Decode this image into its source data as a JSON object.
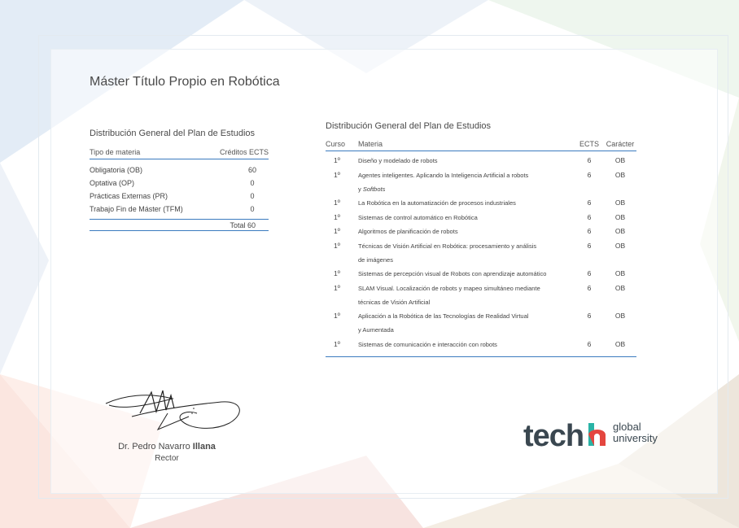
{
  "document": {
    "title": "Máster Título Propio en Robótica"
  },
  "summary_table": {
    "heading": "Distribución General del Plan de Estudios",
    "col_type": "Tipo de materia",
    "col_credits": "Créditos ECTS",
    "rows": [
      {
        "type": "Obligatoria (OB)",
        "credits": "60"
      },
      {
        "type": "Optativa (OP)",
        "credits": "0"
      },
      {
        "type": "Prácticas Externas (PR)",
        "credits": "0"
      },
      {
        "type": "Trabajo Fin de Máster (TFM)",
        "credits": "0"
      }
    ],
    "total": "Total 60"
  },
  "courses_table": {
    "heading": "Distribución General del Plan de Estudios",
    "col_course": "Curso",
    "col_subject": "Materia",
    "col_ects": "ECTS",
    "col_character": "Carácter",
    "rows": [
      {
        "course": "1º",
        "subject": "Diseño y modelado de robots",
        "subject2": "",
        "ects": "6",
        "character": "OB"
      },
      {
        "course": "1º",
        "subject": "Agentes inteligentes. Aplicando la Inteligencia Artificial a robots",
        "subject2": "y Softbots",
        "ects": "6",
        "character": "OB"
      },
      {
        "course": "1º",
        "subject": "La Robótica en la automatización de procesos industriales",
        "subject2": "",
        "ects": "6",
        "character": "OB"
      },
      {
        "course": "1º",
        "subject": "Sistemas de control automático en Robótica",
        "subject2": "",
        "ects": "6",
        "character": "OB"
      },
      {
        "course": "1º",
        "subject": "Algoritmos de planificación de robots",
        "subject2": "",
        "ects": "6",
        "character": "OB"
      },
      {
        "course": "1º",
        "subject": "Técnicas de Visión Artificial en Robótica: procesamiento y análisis",
        "subject2": "de imágenes",
        "ects": "6",
        "character": "OB"
      },
      {
        "course": "1º",
        "subject": "Sistemas de percepción visual de Robots con aprendizaje automático",
        "subject2": "",
        "ects": "6",
        "character": "OB"
      },
      {
        "course": "1º",
        "subject": "SLAM Visual. Localización de robots y mapeo simultáneo mediante",
        "subject2": "técnicas de Visión Artificial",
        "ects": "6",
        "character": "OB"
      },
      {
        "course": "1º",
        "subject": "Aplicación a la Robótica de las Tecnologías de Realidad Virtual",
        "subject2": "y Aumentada",
        "ects": "6",
        "character": "OB"
      },
      {
        "course": "1º",
        "subject": "Sistemas de comunicación e interacción con robots",
        "subject2": "",
        "ects": "6",
        "character": "OB"
      }
    ]
  },
  "signature": {
    "name_prefix": "Dr. Pedro Navarro ",
    "name_bold": "Illana",
    "role": "Rector"
  },
  "logo": {
    "brand": "tech",
    "line1": "global",
    "line2": "university",
    "accent_colors": [
      "#2ab3a6",
      "#f2b632",
      "#e4463f",
      "#3b7bbf"
    ]
  },
  "colors": {
    "rule": "#3b7bbf",
    "text": "#3a3a3a"
  }
}
